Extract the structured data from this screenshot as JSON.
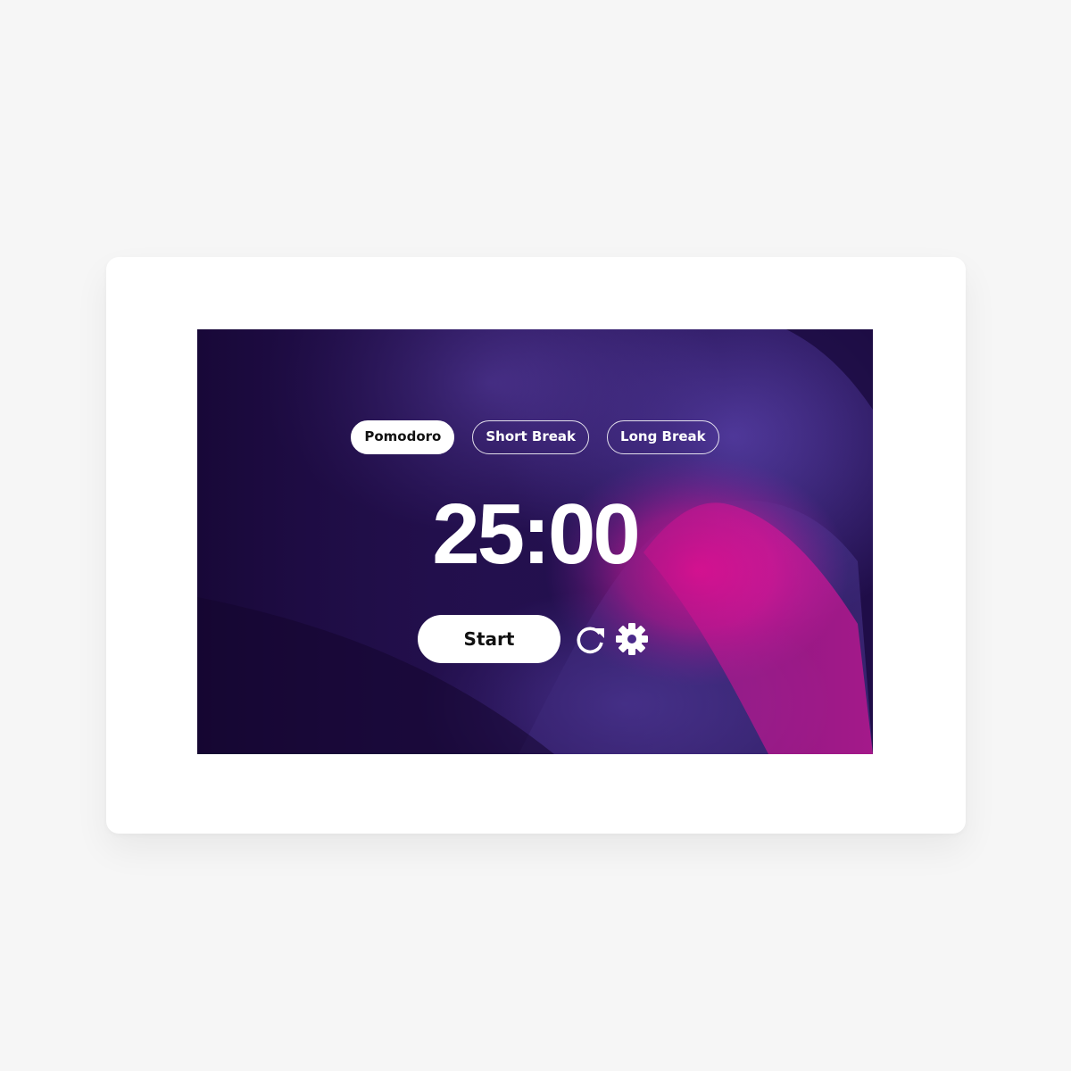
{
  "timer": {
    "modes": [
      {
        "label": "Pomodoro",
        "active": true
      },
      {
        "label": "Short Break",
        "active": false
      },
      {
        "label": "Long Break",
        "active": false
      }
    ],
    "time_display": "25:00",
    "start_label": "Start",
    "icons": {
      "reset": "reset-icon",
      "settings": "gear-icon"
    }
  },
  "colors": {
    "background_dark": "#1c0b42",
    "accent_purple": "#4b3690",
    "accent_pink": "#ff0f9b",
    "button_bg": "#ffffff"
  }
}
